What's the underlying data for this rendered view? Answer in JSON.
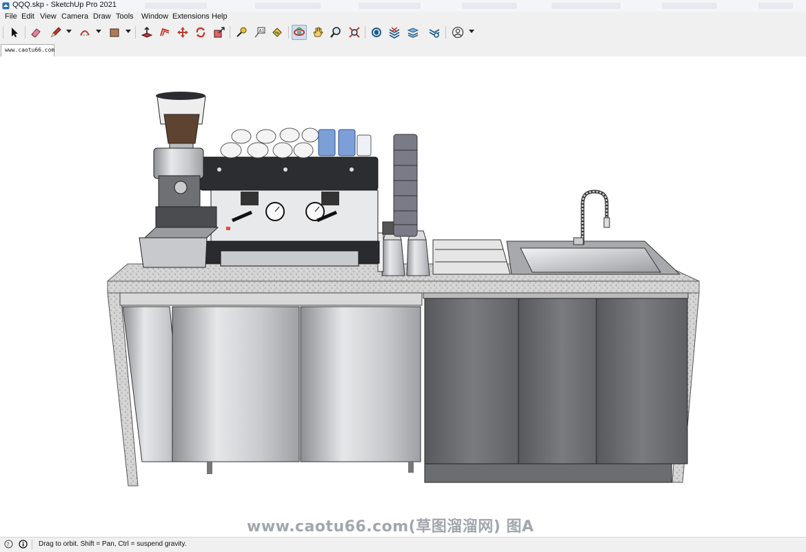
{
  "window": {
    "title": "QQQ.skp - SketchUp Pro 2021"
  },
  "menu": [
    "File",
    "Edit",
    "View",
    "Camera",
    "Draw",
    "Tools",
    "Window",
    "Extensions",
    "Help"
  ],
  "toolbar": [
    {
      "name": "select-tool",
      "icon": "arrow-cursor-icon"
    },
    {
      "name": "eraser-tool",
      "icon": "eraser-icon"
    },
    {
      "name": "line-tool",
      "icon": "pencil-icon"
    },
    {
      "name": "arc-tool",
      "icon": "arc-icon"
    },
    {
      "name": "rectangle-tool",
      "icon": "rectangle-icon"
    },
    {
      "name": "push-pull-tool",
      "icon": "push-pull-icon"
    },
    {
      "name": "offset-tool",
      "icon": "offset-icon"
    },
    {
      "name": "move-tool",
      "icon": "move-arrows-icon"
    },
    {
      "name": "rotate-tool",
      "icon": "rotate-icon"
    },
    {
      "name": "scale-tool",
      "icon": "scale-icon"
    },
    {
      "name": "tape-measure-tool",
      "icon": "tape-measure-icon"
    },
    {
      "name": "text-tool",
      "icon": "text-icon"
    },
    {
      "name": "paint-bucket-tool",
      "icon": "paint-bucket-icon"
    },
    {
      "name": "orbit-tool",
      "icon": "orbit-icon",
      "active": true
    },
    {
      "name": "pan-tool",
      "icon": "hand-icon"
    },
    {
      "name": "zoom-tool",
      "icon": "magnifier-icon"
    },
    {
      "name": "zoom-extents-tool",
      "icon": "zoom-extents-icon"
    },
    {
      "name": "3d-warehouse-button",
      "icon": "warehouse-icon"
    },
    {
      "name": "extension-warehouse-button",
      "icon": "extension-warehouse-icon"
    },
    {
      "name": "layout-button",
      "icon": "layout-icon"
    },
    {
      "name": "extension-manager-button",
      "icon": "extension-manager-icon"
    },
    {
      "name": "account-button",
      "icon": "account-icon"
    }
  ],
  "scene_tab": "www.caotu66.com",
  "watermark": "www.caotu66.com(草图溜溜网) 图A",
  "status": {
    "text": "Drag to orbit. Shift = Pan, Ctrl = suspend gravity."
  },
  "colors": {
    "chrome": "#f0f0f0",
    "counter": "#d6d6d6",
    "cabinet_dark": "#6e6f72",
    "cup_blue": "#7d9fd8"
  }
}
